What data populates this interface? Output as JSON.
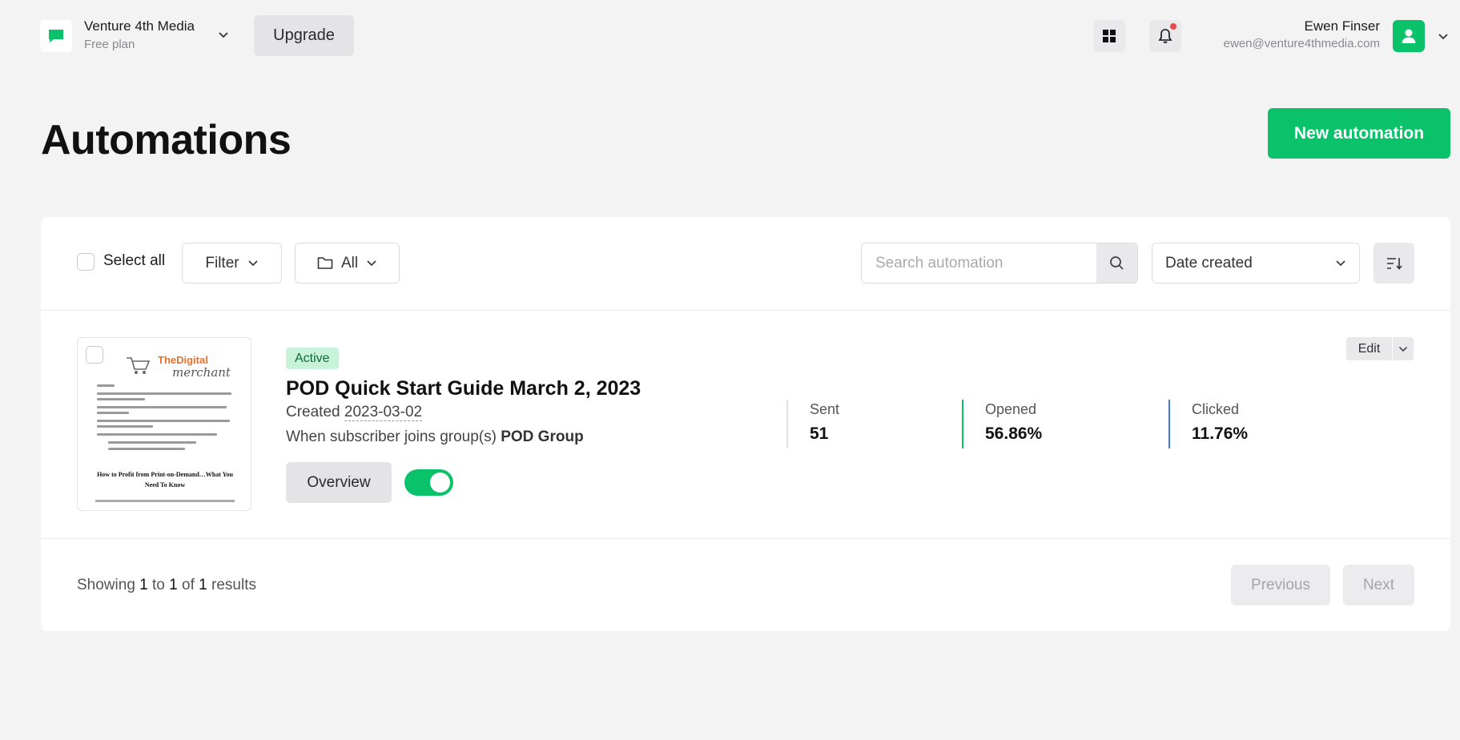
{
  "account": {
    "name": "Venture 4th Media",
    "plan": "Free plan",
    "upgrade_label": "Upgrade"
  },
  "user": {
    "name": "Ewen Finser",
    "email": "ewen@venture4thmedia.com"
  },
  "page": {
    "title": "Automations",
    "new_button": "New automation"
  },
  "toolbar": {
    "select_all": "Select all",
    "filter": "Filter",
    "folder": "All",
    "search_placeholder": "Search automation",
    "sort": "Date created"
  },
  "automations": [
    {
      "status": "Active",
      "title": "POD Quick Start Guide March 2, 2023",
      "created_label": "Created",
      "created_date": "2023-03-02",
      "trigger_text": "When subscriber joins group(s)",
      "trigger_group": "POD Group",
      "overview_label": "Overview",
      "enabled": true,
      "edit_label": "Edit",
      "thumbnail": {
        "brand_top": "TheDigital",
        "brand_bottom": "merchant",
        "heading": "How to Profit from Print-on-Demand…What You Need To Know"
      },
      "stats": [
        {
          "label": "Sent",
          "value": "51",
          "color": ""
        },
        {
          "label": "Opened",
          "value": "56.86%",
          "color": "#09c269"
        },
        {
          "label": "Clicked",
          "value": "11.76%",
          "color": "#3b7bd8"
        }
      ]
    }
  ],
  "pagination": {
    "showing_prefix": "Showing",
    "from": "1",
    "to_word": "to",
    "to": "1",
    "of_word": "of",
    "total": "1",
    "suffix": "results",
    "previous": "Previous",
    "next": "Next"
  },
  "colors": {
    "accent": "#09c269",
    "background": "#f3f3f4"
  }
}
